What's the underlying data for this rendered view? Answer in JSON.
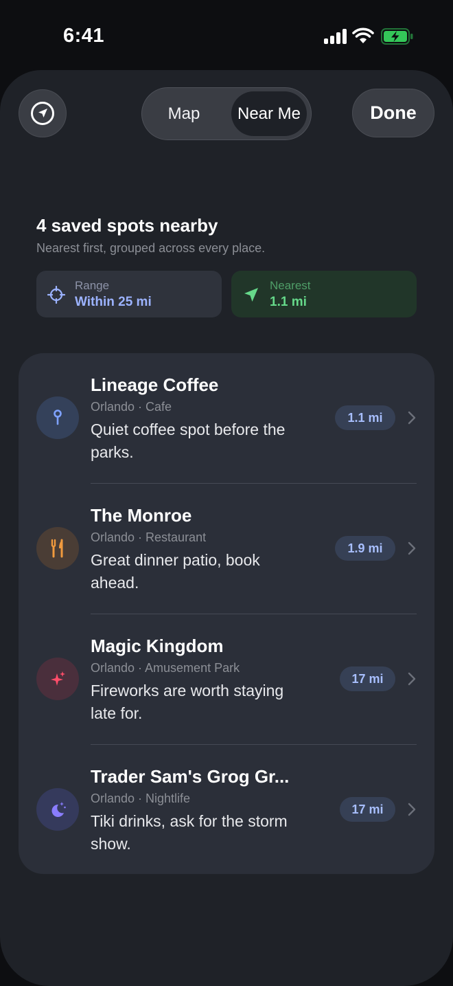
{
  "status_bar": {
    "time": "6:41",
    "icons": [
      "signal-icon",
      "wifi-icon",
      "battery-charging-icon"
    ],
    "battery_color": "#34c759"
  },
  "header": {
    "locate_icon": "location-arrow-icon",
    "segments": [
      {
        "label": "Map",
        "selected": false
      },
      {
        "label": "Near Me",
        "selected": true
      }
    ],
    "done_label": "Done"
  },
  "summary": {
    "title": "4 saved spots nearby",
    "subtitle": "Nearest first, grouped across every place."
  },
  "chips": {
    "range": {
      "label": "Range",
      "value": "Within 25 mi",
      "icon": "crosshair-icon",
      "color": "#9cb3ff"
    },
    "nearest": {
      "label": "Nearest",
      "value": "1.1 mi",
      "icon": "location-arrow-icon",
      "color": "#66d98a"
    }
  },
  "spots": [
    {
      "name": "Lineage Coffee",
      "meta": "Orlando · Cafe",
      "note": "Quiet coffee spot before the parks.",
      "distance": "1.1 mi",
      "icon": "pin-icon",
      "icon_color": "#7fa2ff",
      "icon_bg": "#34415a"
    },
    {
      "name": "The Monroe",
      "meta": "Orlando · Restaurant",
      "note": "Great dinner patio, book ahead.",
      "distance": "1.9 mi",
      "icon": "fork-knife-icon",
      "icon_color": "#f09a3e",
      "icon_bg": "#4a3d35"
    },
    {
      "name": "Magic Kingdom",
      "meta": "Orlando · Amusement Park",
      "note": "Fireworks are worth staying late for.",
      "distance": "17 mi",
      "icon": "sparkles-icon",
      "icon_color": "#ff4d6a",
      "icon_bg": "#4a2f3c"
    },
    {
      "name": "Trader Sam's Grog Gr...",
      "meta": "Orlando · Nightlife",
      "note": "Tiki drinks, ask for the storm show.",
      "distance": "17 mi",
      "icon": "moon-stars-icon",
      "icon_color": "#8a7dff",
      "icon_bg": "#353a5c"
    }
  ]
}
